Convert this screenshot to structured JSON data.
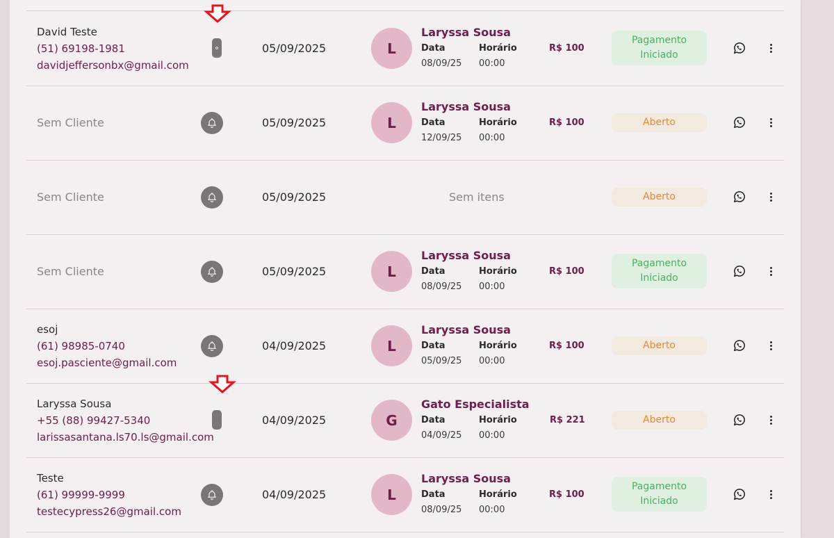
{
  "labels": {
    "date": "Data",
    "time": "Horário"
  },
  "colors": {
    "accent": "#6d2049",
    "status_paid": "#4caf60",
    "status_open": "#e08a3c"
  },
  "rows": [
    {
      "client": {
        "name": "David Teste",
        "phone": "(51) 69198-1981",
        "email": "davidjeffersonbx@gmail.com"
      },
      "notify_icon": "pill-toggle",
      "date": "05/09/2025",
      "professional": {
        "initial": "L",
        "name": "Laryssa Sousa",
        "date": "08/09/25",
        "time": "00:00"
      },
      "price": "R$ 100",
      "status": "Pagamento Iniciado"
    },
    {
      "client": {
        "empty": "Sem Cliente"
      },
      "notify_icon": "bell-icon",
      "date": "05/09/2025",
      "professional": {
        "initial": "L",
        "name": "Laryssa Sousa",
        "date": "12/09/25",
        "time": "00:00"
      },
      "price": "R$ 100",
      "status": "Aberto"
    },
    {
      "client": {
        "empty": "Sem Cliente"
      },
      "notify_icon": "bell-icon",
      "date": "05/09/2025",
      "no_items": "Sem itens",
      "status": "Aberto"
    },
    {
      "client": {
        "empty": "Sem Cliente"
      },
      "notify_icon": "bell-icon",
      "date": "05/09/2025",
      "professional": {
        "initial": "L",
        "name": "Laryssa Sousa",
        "date": "08/09/25",
        "time": "00:00"
      },
      "price": "R$ 100",
      "status": "Pagamento Iniciado"
    },
    {
      "client": {
        "name": "esoj",
        "phone": "(61) 98985-0740",
        "email": "esoj.pasciente@gmail.com"
      },
      "notify_icon": "bell-icon",
      "date": "04/09/2025",
      "professional": {
        "initial": "L",
        "name": "Laryssa Sousa",
        "date": "05/09/25",
        "time": "00:00"
      },
      "price": "R$ 100",
      "status": "Aberto"
    },
    {
      "client": {
        "name": "Laryssa Sousa",
        "phone": "+55 (88) 99427-5340",
        "email": "larissasantana.ls70.ls@gmail.com"
      },
      "notify_icon": "pill-toggle",
      "date": "04/09/2025",
      "professional": {
        "initial": "G",
        "name": "Gato Especialista",
        "date": "04/09/25",
        "time": "00:00"
      },
      "price": "R$ 221",
      "status": "Aberto"
    },
    {
      "client": {
        "name": "Teste",
        "phone": "(61) 99999-9999",
        "email": "testecypress26@gmail.com"
      },
      "notify_icon": "bell-icon",
      "date": "04/09/2025",
      "professional": {
        "initial": "L",
        "name": "Laryssa Sousa",
        "date": "08/09/25",
        "time": "00:00"
      },
      "price": "R$ 100",
      "status": "Pagamento Iniciado"
    }
  ]
}
